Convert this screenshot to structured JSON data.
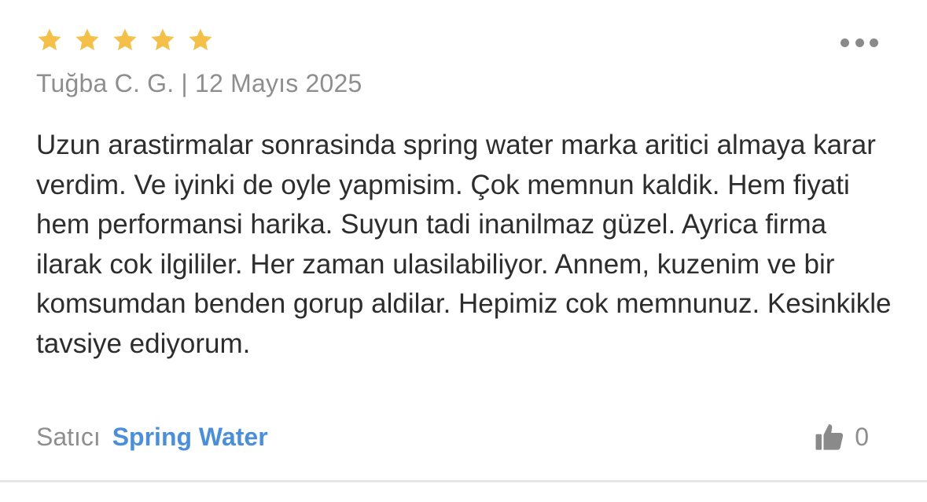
{
  "review": {
    "rating": 5,
    "rating_max": 5,
    "star_color": "#f5c04a",
    "meta": "Tuğba C. G. | 12 Mayıs 2025",
    "text": "Uzun arastirmalar sonrasinda spring water marka aritici almaya karar verdim. Ve iyinki de oyle yapmisim. Çok memnun kaldik. Hem fiyati hem performansi harika. Suyun tadi inanilmaz güzel. Ayrica firma ilarak cok ilgililer. Her zaman ulasilabiliyor. Annem, kuzenim ve bir komsumdan benden gorup aldilar. Hepimiz cok memnunuz. Kesinkikle tavsiye ediyorum.",
    "seller_prefix": "Satıcı",
    "seller_name": "Spring Water",
    "seller_color": "#4a8fd8",
    "helpful_count": "0"
  },
  "icons": {
    "star": "star-icon",
    "more": "more-horizontal-icon",
    "helpful": "thumbs-up-icon"
  }
}
